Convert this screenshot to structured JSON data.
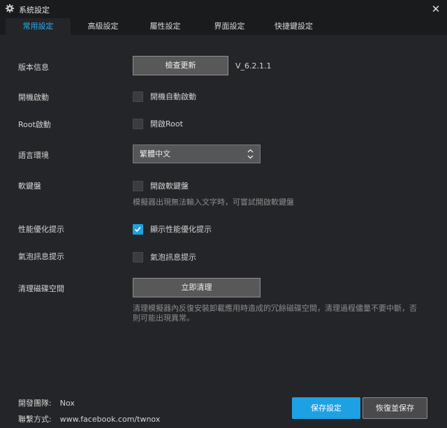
{
  "window": {
    "title": "系統設定",
    "close_icon": "close-icon"
  },
  "tabs": [
    {
      "label": "常用設定",
      "active": true
    },
    {
      "label": "高級設定"
    },
    {
      "label": "屬性設定"
    },
    {
      "label": "界面設定"
    },
    {
      "label": "快捷鍵設定"
    }
  ],
  "version": {
    "label": "版本信息",
    "button": "檢查更新",
    "value": "V_6.2.1.1"
  },
  "boot_start": {
    "label": "開機啟動",
    "option": "開機自動啟動",
    "checked": false
  },
  "root_start": {
    "label": "Root啟動",
    "option": "開啟Root",
    "checked": false
  },
  "language": {
    "label": "語言環境",
    "selected": "繁體中文"
  },
  "soft_keyboard": {
    "label": "軟鍵盤",
    "option": "開啟軟鍵盤",
    "checked": false,
    "hint": "模擬器出現無法輸入文字時，可嘗試開啟軟鍵盤"
  },
  "perf_tip": {
    "label": "性能優化提示",
    "option": "顯示性能優化提示",
    "checked": true
  },
  "bubble_tip": {
    "label": "氣泡訊息提示",
    "option": "氣泡訊息提示",
    "checked": false
  },
  "disk_clean": {
    "label": "清理磁碟空間",
    "button": "立即清理",
    "hint_line1": "清理模擬器內反復安裝卸載應用時造成的冗餘磁碟空間，清理過程儘量不要中斷，否",
    "hint_line2": "則可能出現異常。"
  },
  "footer": {
    "team_label": "開發團隊:",
    "team_value": "Nox",
    "contact_label": "聯繫方式:",
    "contact_value": "www.facebook.com/twnox",
    "save_button": "保存設定",
    "restore_button": "恢復並保存"
  },
  "colors": {
    "accent": "#1da1e2",
    "active_tab_text": "#29aef0",
    "background": "#242528",
    "titlebar": "#1a1b1d"
  }
}
